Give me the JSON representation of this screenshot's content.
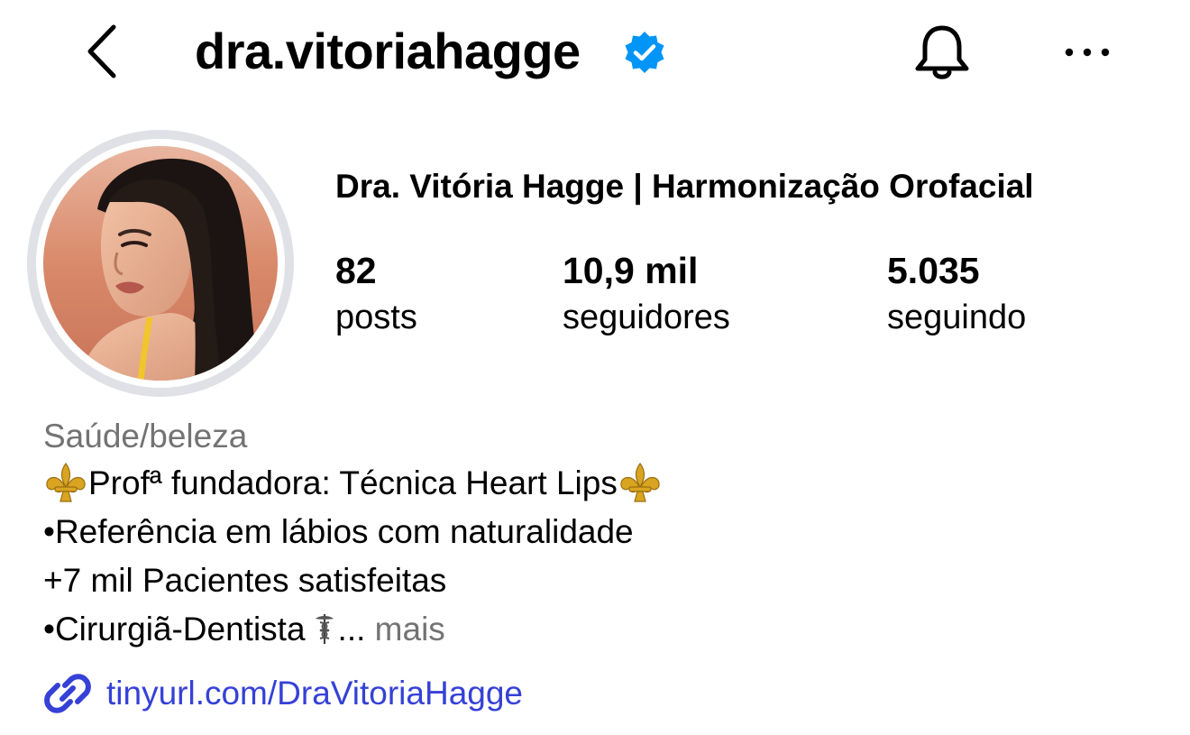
{
  "header": {
    "back_icon": "chevron-left-icon",
    "username": "dra.vitoriahagge",
    "verified_icon": "verified-badge-icon",
    "bell_icon": "bell-icon",
    "more_icon": "more-horizontal-icon"
  },
  "profile": {
    "avatar": "profile-photo",
    "display_name": "Dra. Vitória Hagge | Harmonização Orofacial",
    "stats": [
      {
        "value": "82",
        "label": "posts"
      },
      {
        "value": "10,9 mil",
        "label": "seguidores"
      },
      {
        "value": "5.035",
        "label": "seguindo"
      }
    ],
    "category": "Saúde/beleza",
    "bio": {
      "line1": "Profª fundadora: Técnica Heart Lips",
      "line2": "•Referência em lábios com naturalidade",
      "line3": "+7 mil Pacientes satisfeitas",
      "line4": "•Cirurgiã-Dentista",
      "ellipsis": "...",
      "more": "mais"
    },
    "link": {
      "icon": "link-icon",
      "text": "tinyurl.com/DraVitoriaHagge"
    }
  },
  "colors": {
    "verified": "#0095f6",
    "link": "#3541d6",
    "secondary_text": "#737373",
    "avatar_ring": "#dfe1e6"
  }
}
